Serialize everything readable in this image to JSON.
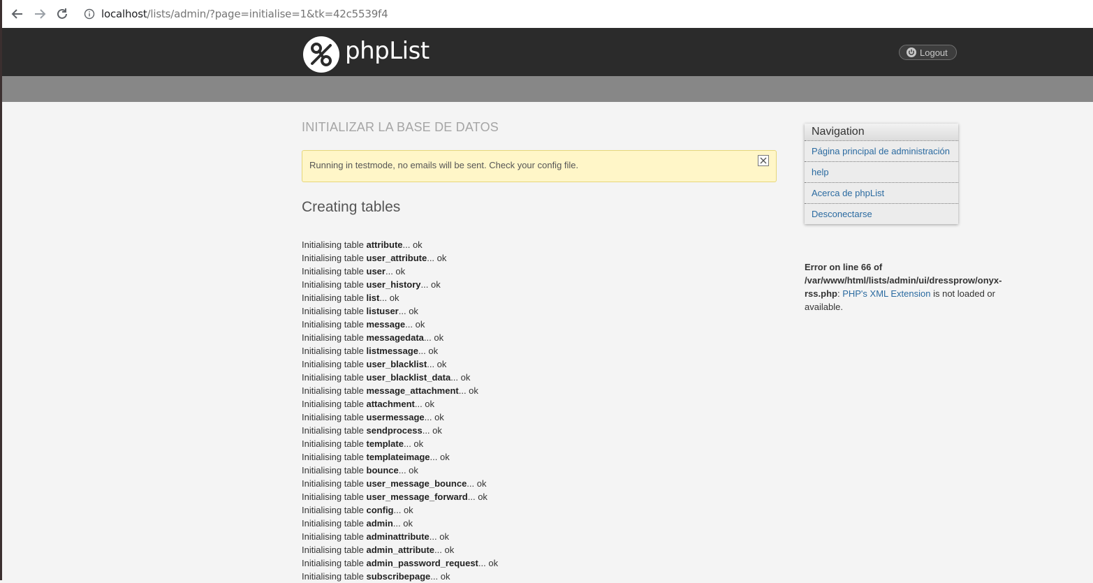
{
  "browser": {
    "url_host": "localhost",
    "url_rest": "/lists/admin/?page=initialise=1&tk=42c5539f4"
  },
  "header": {
    "logo_text": "phpList",
    "logout_label": "Logout"
  },
  "page": {
    "title": "INITIALIZAR LA BASE DE DATOS",
    "alert_text": "Running in testmode, no emails will be sent. Check your config file.",
    "section_heading": "Creating tables",
    "line_prefix": "Initialising table ",
    "line_suffix": "... ok",
    "tables": [
      {
        "name": "attribute"
      },
      {
        "name": "user_attribute"
      },
      {
        "name": "user"
      },
      {
        "name": "user_history"
      },
      {
        "name": "list"
      },
      {
        "name": "listuser"
      },
      {
        "name": "message"
      },
      {
        "name": "messagedata"
      },
      {
        "name": "listmessage"
      },
      {
        "name": "user_blacklist"
      },
      {
        "name": "user_blacklist_data"
      },
      {
        "name": "message_attachment"
      },
      {
        "name": "attachment"
      },
      {
        "name": "usermessage"
      },
      {
        "name": "sendprocess"
      },
      {
        "name": "template"
      },
      {
        "name": "templateimage"
      },
      {
        "name": "bounce"
      },
      {
        "name": "user_message_bounce"
      },
      {
        "name": "user_message_forward"
      },
      {
        "name": "config"
      },
      {
        "name": "admin"
      },
      {
        "name": "adminattribute"
      },
      {
        "name": "admin_attribute"
      },
      {
        "name": "admin_password_request"
      },
      {
        "name": "subscribepage"
      }
    ]
  },
  "navigation": {
    "title": "Navigation",
    "items": [
      {
        "label": "Página principal de administración"
      },
      {
        "label": "help"
      },
      {
        "label": "Acerca de phpList"
      },
      {
        "label": "Desconectarse"
      }
    ]
  },
  "error": {
    "bold_text": "Error on line 66 of /var/www/html/lists/admin/ui/dressprow/onyx-rss.php",
    "separator": ": ",
    "link_text": "PHP's XML Extension",
    "tail_text": " is not loaded or available."
  },
  "colors": {
    "header_bg": "#2b2b2b",
    "subheader_bg": "#878787",
    "link": "#2a6aa0",
    "alert_bg": "#fff6c8"
  },
  "icons": [
    "back-arrow-icon",
    "forward-arrow-icon",
    "reload-icon",
    "info-icon",
    "phplist-logo-icon",
    "power-icon",
    "close-icon"
  ]
}
